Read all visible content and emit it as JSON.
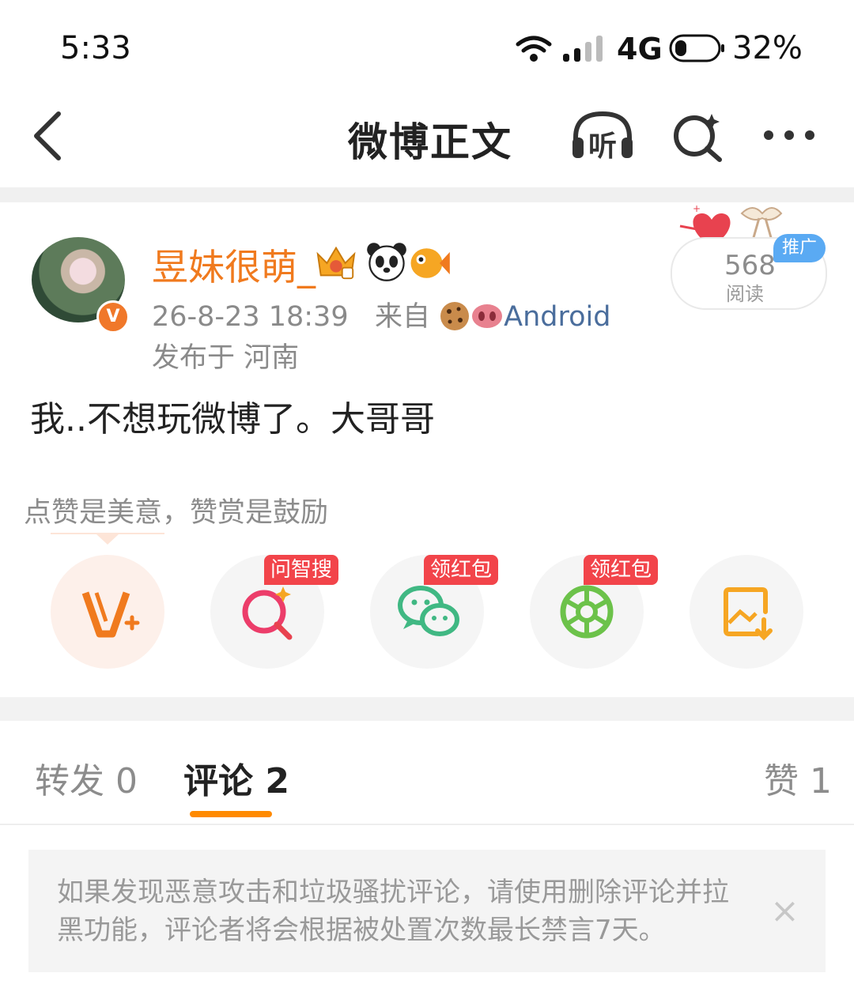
{
  "status_bar": {
    "time": "5:33",
    "network": "4G",
    "battery_percent": "32%",
    "battery_level": 0.32
  },
  "nav": {
    "title": "微博正文",
    "listen_label": "听"
  },
  "post": {
    "username": "昱妹很萌_",
    "time": "26-8-23 18:39",
    "from_prefix": "来自",
    "source": "Android",
    "location": "发布于 河南",
    "text": "我..不想玩微博了。大哥哥",
    "verified_mark": "V",
    "read_count": "568",
    "read_label": "阅读",
    "promo_label": "推广"
  },
  "reward": {
    "tip": "点赞是美意，赞赏是鼓励",
    "actions": [
      {
        "name": "vplus",
        "tag": ""
      },
      {
        "name": "search",
        "tag": "问智搜"
      },
      {
        "name": "wechat",
        "tag": "领红包"
      },
      {
        "name": "moments",
        "tag": "领红包"
      },
      {
        "name": "save-image",
        "tag": ""
      }
    ]
  },
  "tabs": {
    "repost": "转发 0",
    "comment": "评论 2",
    "like": "赞 1"
  },
  "notice": {
    "text": "如果发现恶意攻击和垃圾骚扰评论，请使用删除评论并拉黑功能，评论者将会根据被处置次数最长禁言7天。",
    "close": "×"
  },
  "colors": {
    "accent_orange": "#f07a1e",
    "tab_indicator": "#ff8a00",
    "link_blue": "#4a6d9c",
    "tag_red": "#f2444a"
  }
}
